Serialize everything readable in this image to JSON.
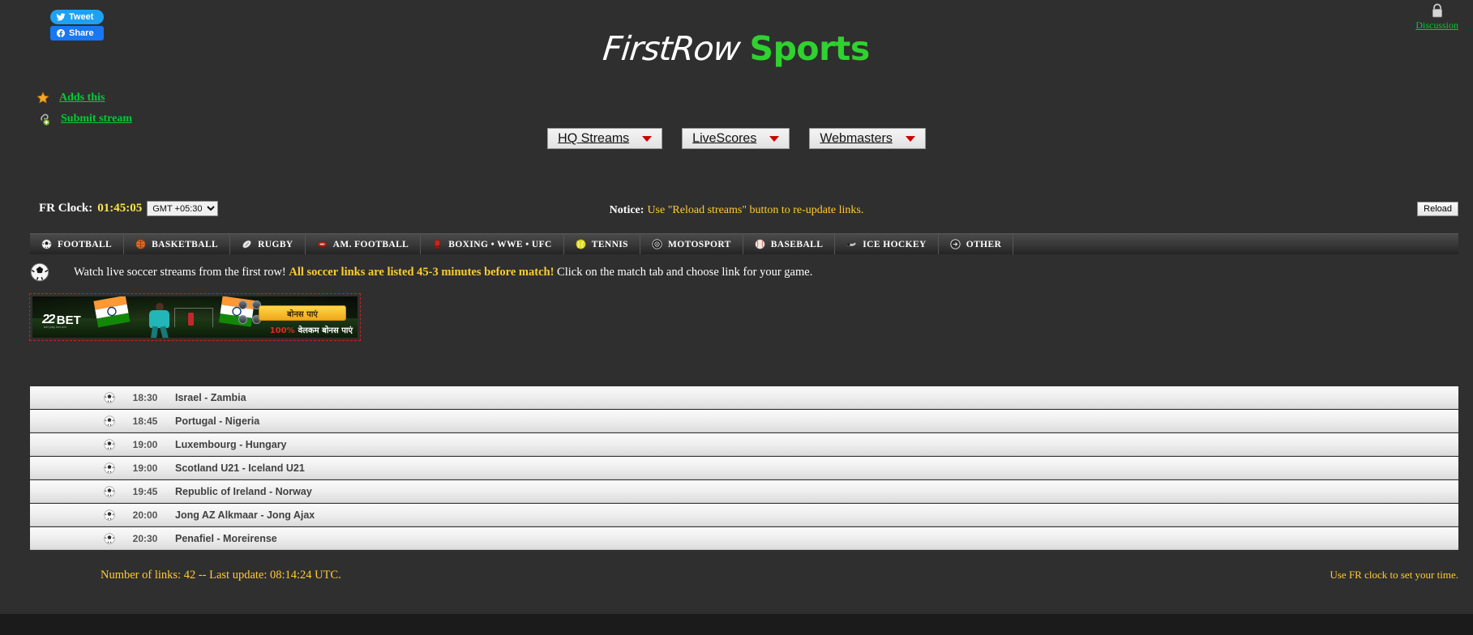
{
  "site": {
    "logo_first": "FirstRow",
    "logo_second": "Sports"
  },
  "social": {
    "tweet_label": "Tweet",
    "share_label": "Share",
    "tweet_icon": "twitter-bird-icon",
    "share_icon": "facebook-icon"
  },
  "discussion": {
    "label": "Discussion",
    "icon": "lock-icon"
  },
  "sidelinks": [
    {
      "label": "Adds this",
      "icon": "star-icon"
    },
    {
      "label": "Submit stream",
      "icon": "link-add-icon"
    }
  ],
  "topnav": [
    {
      "label": "HQ Streams",
      "icon": "chevron-down-icon"
    },
    {
      "label": "LiveScores",
      "icon": "chevron-down-icon"
    },
    {
      "label": "Webmasters",
      "icon": "chevron-down-icon"
    }
  ],
  "clock": {
    "label": "FR Clock:",
    "time": "01:45:05",
    "timezone_selected": "GMT +05:30",
    "timezone_options": [
      "GMT +05:30"
    ]
  },
  "notice": {
    "prefix": "Notice:",
    "text": "Use \"Reload streams\" button to re-update links."
  },
  "reload": {
    "label": "Reload"
  },
  "tabs": [
    {
      "label": "FOOTBALL",
      "icon": "soccer-ball-icon"
    },
    {
      "label": "BASKETBALL",
      "icon": "basketball-icon"
    },
    {
      "label": "RUGBY",
      "icon": "rugby-ball-icon"
    },
    {
      "label": "AM. FOOTBALL",
      "icon": "american-football-icon"
    },
    {
      "label": "BOXING • WWE • UFC",
      "icon": "boxing-glove-icon"
    },
    {
      "label": "TENNIS",
      "icon": "tennis-ball-icon"
    },
    {
      "label": "MOTOSPORT",
      "icon": "tire-icon"
    },
    {
      "label": "BASEBALL",
      "icon": "baseball-icon"
    },
    {
      "label": "ICE HOCKEY",
      "icon": "hockey-puck-icon"
    },
    {
      "label": "OTHER",
      "icon": "arrow-right-circle-icon"
    }
  ],
  "intro": {
    "icon": "soccer-ball-icon",
    "part1": "Watch live soccer streams from the first row!",
    "highlight": "All soccer links are listed 45-3 minutes before match!",
    "part2": "Click on the match tab and choose link for your game."
  },
  "ad": {
    "brand_mark": "22",
    "brand_name": "BET",
    "brand_tagline": "bet  play  bet  win",
    "cta": "बोनस पाएं",
    "sub_percent": "100%",
    "sub_text": "वेलकम बोनस पाएं"
  },
  "matches": [
    {
      "icon": "soccer-ball-icon",
      "time": "18:30",
      "teams": "Israel - Zambia"
    },
    {
      "icon": "soccer-ball-icon",
      "time": "18:45",
      "teams": "Portugal - Nigeria"
    },
    {
      "icon": "soccer-ball-icon",
      "time": "19:00",
      "teams": "Luxembourg - Hungary"
    },
    {
      "icon": "soccer-ball-icon",
      "time": "19:00",
      "teams": "Scotland U21 - Iceland U21"
    },
    {
      "icon": "soccer-ball-icon",
      "time": "19:45",
      "teams": "Republic of Ireland - Norway"
    },
    {
      "icon": "soccer-ball-icon",
      "time": "20:00",
      "teams": "Jong AZ Alkmaar - Jong Ajax"
    },
    {
      "icon": "soccer-ball-icon",
      "time": "20:30",
      "teams": "Penafiel - Moreirense"
    }
  ],
  "footer": {
    "left": "Number of links: 42 -- Last update: 08:14:24 UTC.",
    "right": "Use FR clock to set your time."
  },
  "colors": {
    "background": "#2f2f2f",
    "accent_green": "#00cc33",
    "accent_yellow": "#ffcc33",
    "logo_green": "#2fd22f",
    "caret_red": "#cc0000"
  }
}
